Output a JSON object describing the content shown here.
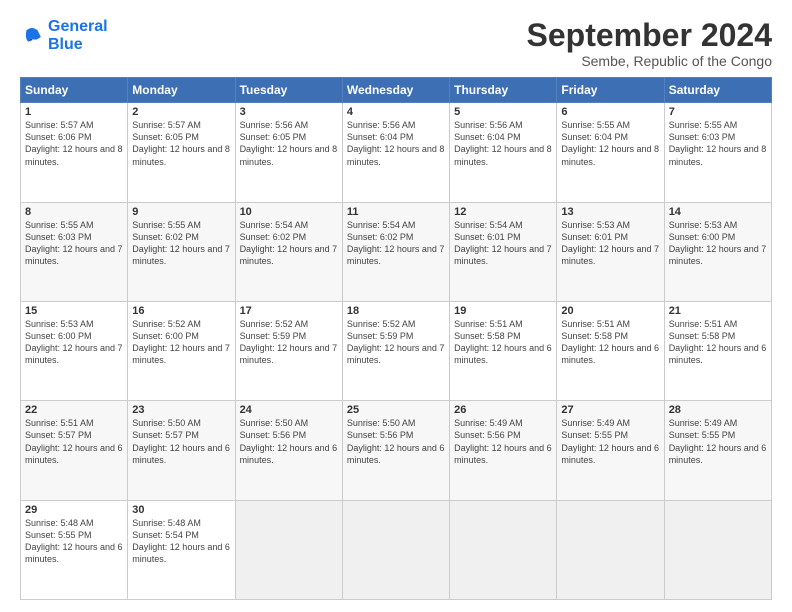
{
  "logo": {
    "line1": "General",
    "line2": "Blue"
  },
  "title": "September 2024",
  "subtitle": "Sembe, Republic of the Congo",
  "days_of_week": [
    "Sunday",
    "Monday",
    "Tuesday",
    "Wednesday",
    "Thursday",
    "Friday",
    "Saturday"
  ],
  "weeks": [
    [
      {
        "day": "1",
        "sunrise": "5:57 AM",
        "sunset": "6:06 PM",
        "daylight": "12 hours and 8 minutes."
      },
      {
        "day": "2",
        "sunrise": "5:57 AM",
        "sunset": "6:05 PM",
        "daylight": "12 hours and 8 minutes."
      },
      {
        "day": "3",
        "sunrise": "5:56 AM",
        "sunset": "6:05 PM",
        "daylight": "12 hours and 8 minutes."
      },
      {
        "day": "4",
        "sunrise": "5:56 AM",
        "sunset": "6:04 PM",
        "daylight": "12 hours and 8 minutes."
      },
      {
        "day": "5",
        "sunrise": "5:56 AM",
        "sunset": "6:04 PM",
        "daylight": "12 hours and 8 minutes."
      },
      {
        "day": "6",
        "sunrise": "5:55 AM",
        "sunset": "6:04 PM",
        "daylight": "12 hours and 8 minutes."
      },
      {
        "day": "7",
        "sunrise": "5:55 AM",
        "sunset": "6:03 PM",
        "daylight": "12 hours and 8 minutes."
      }
    ],
    [
      {
        "day": "8",
        "sunrise": "5:55 AM",
        "sunset": "6:03 PM",
        "daylight": "12 hours and 7 minutes."
      },
      {
        "day": "9",
        "sunrise": "5:55 AM",
        "sunset": "6:02 PM",
        "daylight": "12 hours and 7 minutes."
      },
      {
        "day": "10",
        "sunrise": "5:54 AM",
        "sunset": "6:02 PM",
        "daylight": "12 hours and 7 minutes."
      },
      {
        "day": "11",
        "sunrise": "5:54 AM",
        "sunset": "6:02 PM",
        "daylight": "12 hours and 7 minutes."
      },
      {
        "day": "12",
        "sunrise": "5:54 AM",
        "sunset": "6:01 PM",
        "daylight": "12 hours and 7 minutes."
      },
      {
        "day": "13",
        "sunrise": "5:53 AM",
        "sunset": "6:01 PM",
        "daylight": "12 hours and 7 minutes."
      },
      {
        "day": "14",
        "sunrise": "5:53 AM",
        "sunset": "6:00 PM",
        "daylight": "12 hours and 7 minutes."
      }
    ],
    [
      {
        "day": "15",
        "sunrise": "5:53 AM",
        "sunset": "6:00 PM",
        "daylight": "12 hours and 7 minutes."
      },
      {
        "day": "16",
        "sunrise": "5:52 AM",
        "sunset": "6:00 PM",
        "daylight": "12 hours and 7 minutes."
      },
      {
        "day": "17",
        "sunrise": "5:52 AM",
        "sunset": "5:59 PM",
        "daylight": "12 hours and 7 minutes."
      },
      {
        "day": "18",
        "sunrise": "5:52 AM",
        "sunset": "5:59 PM",
        "daylight": "12 hours and 7 minutes."
      },
      {
        "day": "19",
        "sunrise": "5:51 AM",
        "sunset": "5:58 PM",
        "daylight": "12 hours and 6 minutes."
      },
      {
        "day": "20",
        "sunrise": "5:51 AM",
        "sunset": "5:58 PM",
        "daylight": "12 hours and 6 minutes."
      },
      {
        "day": "21",
        "sunrise": "5:51 AM",
        "sunset": "5:58 PM",
        "daylight": "12 hours and 6 minutes."
      }
    ],
    [
      {
        "day": "22",
        "sunrise": "5:51 AM",
        "sunset": "5:57 PM",
        "daylight": "12 hours and 6 minutes."
      },
      {
        "day": "23",
        "sunrise": "5:50 AM",
        "sunset": "5:57 PM",
        "daylight": "12 hours and 6 minutes."
      },
      {
        "day": "24",
        "sunrise": "5:50 AM",
        "sunset": "5:56 PM",
        "daylight": "12 hours and 6 minutes."
      },
      {
        "day": "25",
        "sunrise": "5:50 AM",
        "sunset": "5:56 PM",
        "daylight": "12 hours and 6 minutes."
      },
      {
        "day": "26",
        "sunrise": "5:49 AM",
        "sunset": "5:56 PM",
        "daylight": "12 hours and 6 minutes."
      },
      {
        "day": "27",
        "sunrise": "5:49 AM",
        "sunset": "5:55 PM",
        "daylight": "12 hours and 6 minutes."
      },
      {
        "day": "28",
        "sunrise": "5:49 AM",
        "sunset": "5:55 PM",
        "daylight": "12 hours and 6 minutes."
      }
    ],
    [
      {
        "day": "29",
        "sunrise": "5:48 AM",
        "sunset": "5:55 PM",
        "daylight": "12 hours and 6 minutes."
      },
      {
        "day": "30",
        "sunrise": "5:48 AM",
        "sunset": "5:54 PM",
        "daylight": "12 hours and 6 minutes."
      },
      null,
      null,
      null,
      null,
      null
    ]
  ]
}
